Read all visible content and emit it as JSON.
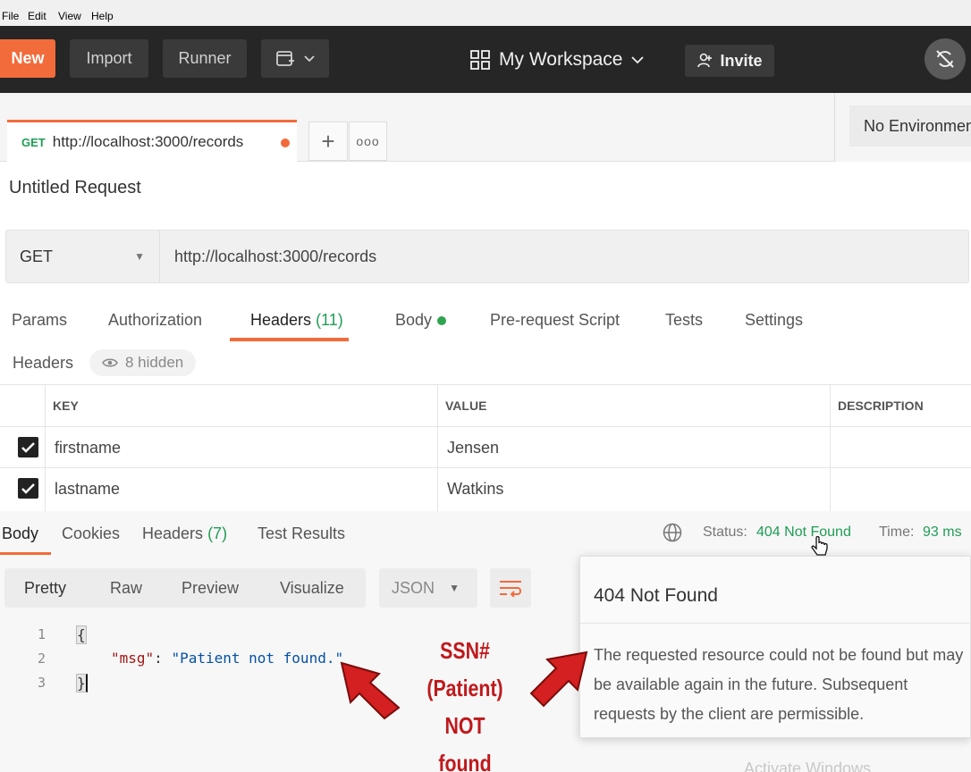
{
  "menubar": {
    "items": [
      "File",
      "Edit",
      "View",
      "Help"
    ]
  },
  "topbar": {
    "new_label": "New",
    "import_label": "Import",
    "runner_label": "Runner",
    "workspace_label": "My Workspace",
    "invite_label": "Invite"
  },
  "tabs": {
    "active_method": "GET",
    "active_url": "http://localhost:3000/records",
    "environment": "No Environment"
  },
  "request": {
    "title": "Untitled Request",
    "method": "GET",
    "url": "http://localhost:3000/records",
    "tabs": {
      "params": "Params",
      "authorization": "Authorization",
      "headers": "Headers",
      "headers_count": "(11)",
      "body": "Body",
      "prerequest": "Pre-request Script",
      "tests": "Tests",
      "settings": "Settings"
    },
    "headers_label": "Headers",
    "hidden_label": "8 hidden",
    "table": {
      "columns": [
        "KEY",
        "VALUE",
        "DESCRIPTION"
      ],
      "rows": [
        {
          "key": "firstname",
          "value": "Jensen",
          "description": ""
        },
        {
          "key": "lastname",
          "value": "Watkins",
          "description": ""
        }
      ]
    }
  },
  "response": {
    "tabs": {
      "body": "Body",
      "cookies": "Cookies",
      "headers": "Headers",
      "headers_count": "(7)",
      "test_results": "Test Results"
    },
    "status_label": "Status:",
    "status_value": "404 Not Found",
    "time_label": "Time:",
    "time_value": "93 ms",
    "views": [
      "Pretty",
      "Raw",
      "Preview",
      "Visualize"
    ],
    "format": "JSON",
    "code": {
      "line_numbers": [
        "1",
        "2",
        "3"
      ],
      "open_brace": "{",
      "key": "\"msg\"",
      "colon": ": ",
      "value": "\"Patient not found.\"",
      "close_brace": "}"
    }
  },
  "tooltip": {
    "title": "404 Not Found",
    "body": "The requested resource could not be found but may be available again in the future. Subsequent requests by the client are permissible."
  },
  "annotation": {
    "line1": "SSN# (Patient)",
    "line2": "NOT",
    "line3": "found",
    "color": "#c0191c"
  },
  "watermark": "Activate Windows",
  "colors": {
    "accent": "#f26b3a",
    "success": "#1f9d55",
    "topbar": "#262626"
  }
}
